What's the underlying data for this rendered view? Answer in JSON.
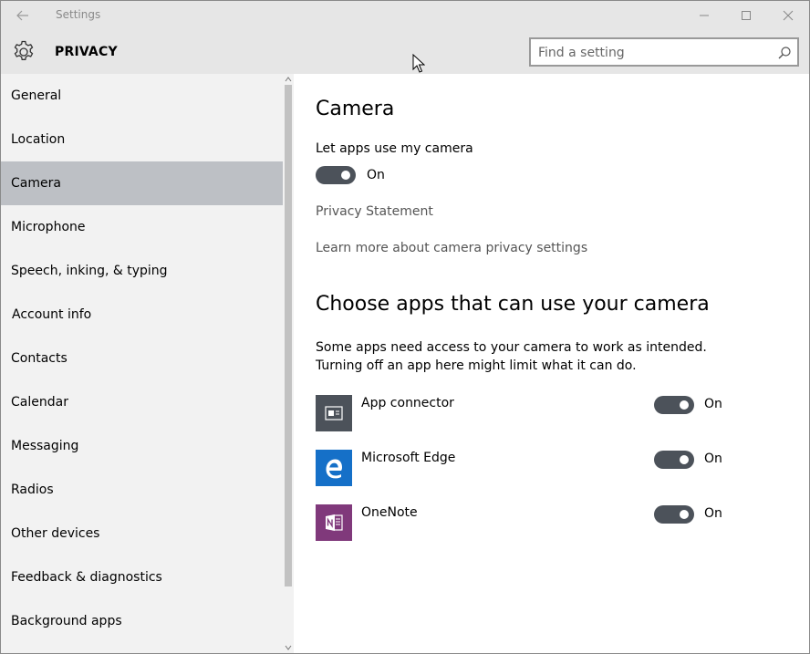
{
  "window": {
    "title": "Settings"
  },
  "header": {
    "title": "PRIVACY",
    "search_placeholder": "Find a setting"
  },
  "sidebar": {
    "items": [
      {
        "label": "General"
      },
      {
        "label": "Location"
      },
      {
        "label": "Camera",
        "selected": true
      },
      {
        "label": "Microphone"
      },
      {
        "label": "Speech, inking, & typing"
      },
      {
        "label": "Account info"
      },
      {
        "label": "Contacts"
      },
      {
        "label": "Calendar"
      },
      {
        "label": "Messaging"
      },
      {
        "label": "Radios"
      },
      {
        "label": "Other devices"
      },
      {
        "label": "Feedback & diagnostics"
      },
      {
        "label": "Background apps"
      }
    ]
  },
  "main": {
    "title": "Camera",
    "master_toggle_label": "Let apps use my camera",
    "master_toggle_state": "On",
    "privacy_link": "Privacy Statement",
    "learn_more_link": "Learn more about camera privacy settings",
    "section_title": "Choose apps that can use your camera",
    "description_line1": "Some apps need access to your camera to work as intended.",
    "description_line2": "Turning off an app here might limit what it can do.",
    "apps": [
      {
        "name": "App connector",
        "state": "On",
        "icon": "app-connector-icon",
        "icon_color": "#4c525a"
      },
      {
        "name": "Microsoft Edge",
        "state": "On",
        "icon": "edge-icon",
        "icon_color": "#1570c8"
      },
      {
        "name": "OneNote",
        "state": "On",
        "icon": "onenote-icon",
        "icon_color": "#80397b"
      }
    ]
  },
  "colors": {
    "selected_nav": "#bdc0c5",
    "toggle_on": "#4c525a",
    "sidebar_bg": "#f2f2f2",
    "chrome_bg": "#e6e6e6"
  }
}
